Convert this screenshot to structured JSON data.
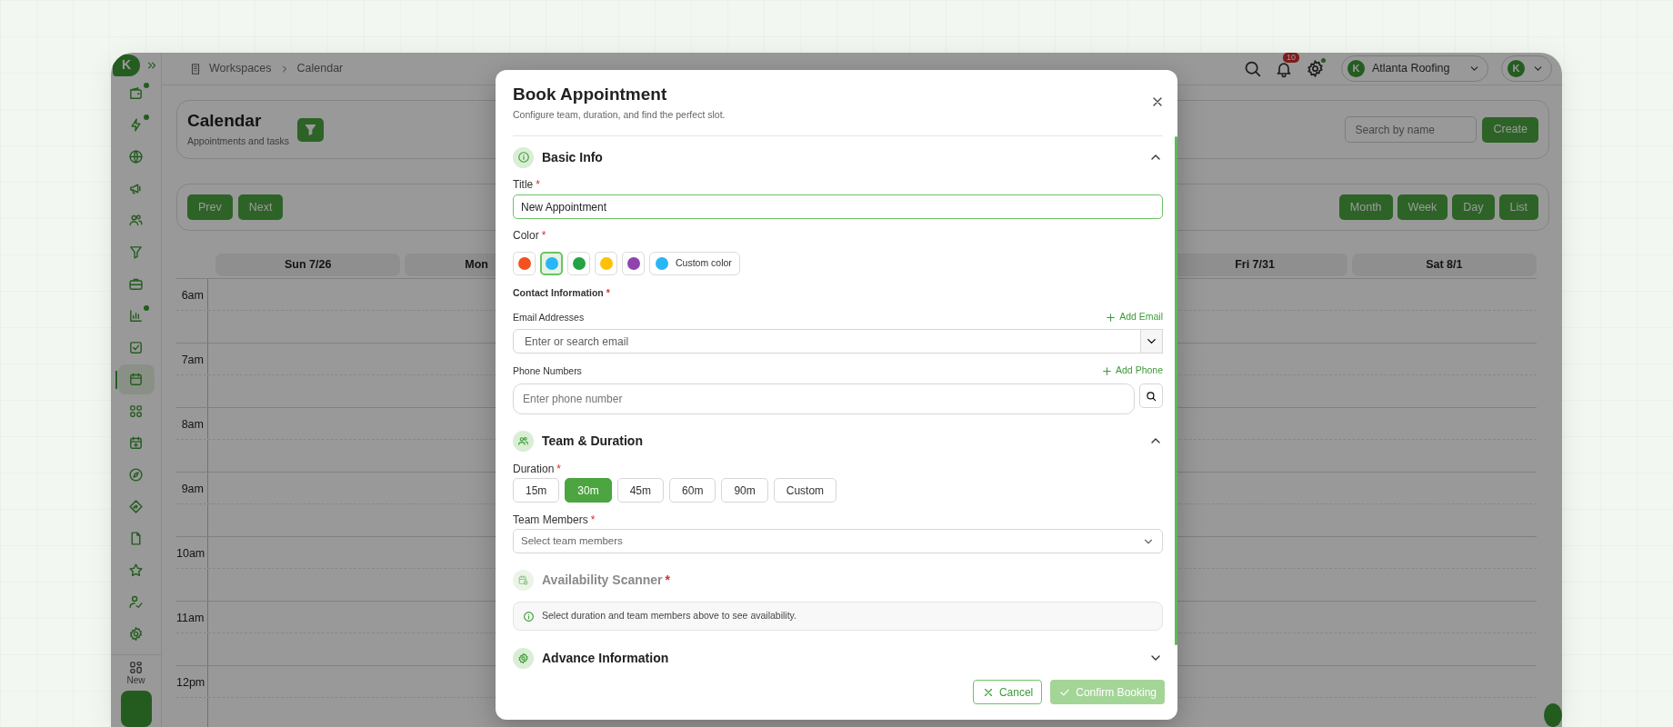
{
  "sidebar": {
    "logo": "K",
    "items": [
      {
        "dot": true,
        "selected": false
      },
      {
        "dot": true,
        "selected": false
      },
      {
        "dot": false,
        "selected": false
      },
      {
        "dot": false,
        "selected": false
      },
      {
        "dot": false,
        "selected": false
      },
      {
        "dot": false,
        "selected": false
      },
      {
        "dot": false,
        "selected": false
      },
      {
        "dot": true,
        "selected": false
      },
      {
        "dot": false,
        "selected": false
      },
      {
        "dot": false,
        "selected": true
      },
      {
        "dot": false,
        "selected": false
      },
      {
        "dot": false,
        "selected": false
      },
      {
        "dot": false,
        "selected": false
      },
      {
        "dot": false,
        "selected": false
      },
      {
        "dot": false,
        "selected": false
      },
      {
        "dot": false,
        "selected": false
      },
      {
        "dot": false,
        "selected": false
      },
      {
        "dot": false,
        "selected": false
      }
    ],
    "new_label": "New"
  },
  "topbar": {
    "breadcrumb": [
      "Workspaces",
      "Calendar"
    ],
    "notifications": "10",
    "settings_alert": true,
    "workspace": {
      "avatar": "K",
      "name": "Atlanta Roofing"
    },
    "profile": {
      "avatar": "K"
    }
  },
  "calendar": {
    "title": "Calendar",
    "subtitle": "Appointments and tasks",
    "search_placeholder": "Search by name",
    "create": "Create",
    "nav": [
      "Prev",
      "Next"
    ],
    "views": [
      "Month",
      "Week",
      "Day",
      "List"
    ],
    "days": [
      "Sun 7/26",
      "Mon",
      "Fri 7/31",
      "Sat 8/1"
    ],
    "hours": [
      "6am",
      "7am",
      "8am",
      "9am",
      "10am",
      "11am",
      "12pm"
    ]
  },
  "modal": {
    "title": "Book Appointment",
    "subtitle": "Configure team, duration, and find the perfect slot.",
    "basic": {
      "heading": "Basic Info",
      "expanded": true,
      "title_label": {
        "text": "Title",
        "mark": "*"
      },
      "title_value": "New Appointment",
      "color_label": {
        "text": "Color",
        "mark": "*"
      },
      "colors": [
        {
          "color": "#f4511e",
          "selected": false
        },
        {
          "color": "#29b6f6",
          "selected": true
        },
        {
          "color": "#25a244",
          "selected": false
        },
        {
          "color": "#ffc107",
          "selected": false
        },
        {
          "color": "#8e44ad",
          "selected": false
        }
      ],
      "custom_color": {
        "label": "Custom color",
        "color": "#29b6f6"
      },
      "contact_label": {
        "text": "Contact Information",
        "mark": "*"
      },
      "email_label": "Email Addresses",
      "add_email": "Add Email",
      "email_placeholder": "Enter or search email",
      "phone_label": "Phone Numbers",
      "add_phone": "Add Phone",
      "phone_placeholder": "Enter phone number"
    },
    "team": {
      "heading": "Team & Duration",
      "expanded": true,
      "duration_label": {
        "text": "Duration",
        "mark": "*"
      },
      "durations": [
        {
          "label": "15m",
          "selected": false
        },
        {
          "label": "30m",
          "selected": true
        },
        {
          "label": "45m",
          "selected": false
        },
        {
          "label": "60m",
          "selected": false
        },
        {
          "label": "90m",
          "selected": false
        },
        {
          "label": "Custom",
          "selected": false
        }
      ],
      "members_label": {
        "text": "Team Members",
        "mark": "*"
      },
      "members_placeholder": "Select team members"
    },
    "scanner": {
      "heading": {
        "text": "Availability Scanner",
        "mark": "*"
      },
      "disabled": true,
      "note": "Select duration and team members above to see availability."
    },
    "advance": {
      "heading": "Advance Information",
      "expanded": false
    },
    "footer": {
      "cancel": "Cancel",
      "confirm": {
        "label": "Confirm Booking",
        "disabled": true
      }
    }
  }
}
